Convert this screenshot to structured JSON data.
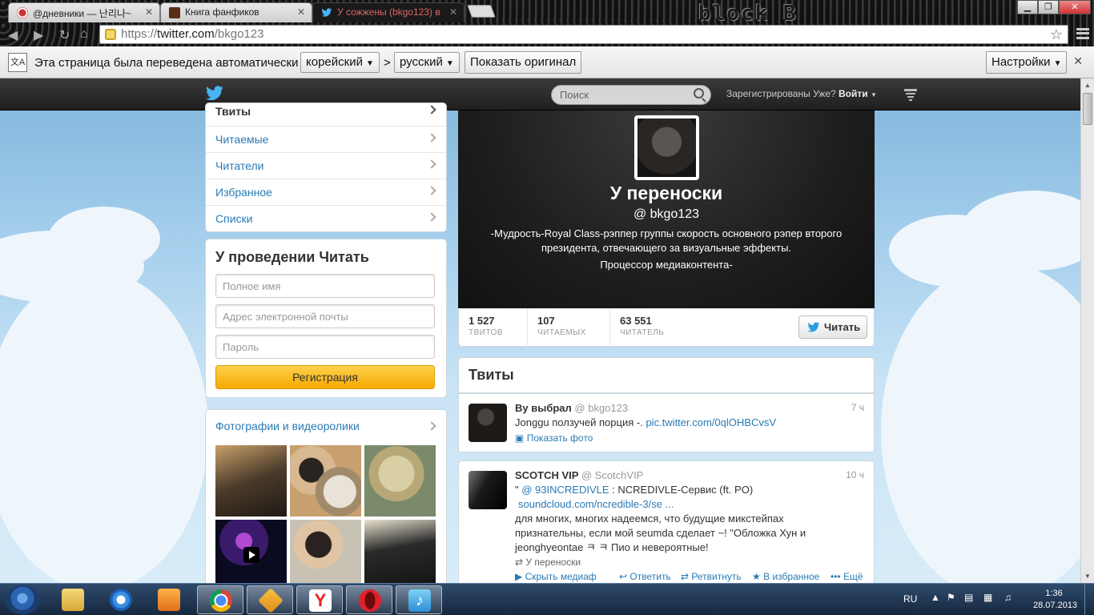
{
  "browser": {
    "tabs": [
      {
        "title": "@дневники — 난리나~",
        "active": false
      },
      {
        "title": "Книга фанфиков",
        "active": false
      },
      {
        "title": "У сожжены (bkgo123) в",
        "active": true
      }
    ],
    "brand_logo": "block B",
    "url_scheme": "https://",
    "url_host": "twitter.com",
    "url_path": "/bkgo123",
    "translate_bar": {
      "message": "Эта страница была переведена автоматически",
      "from_lang": "корейский",
      "separator": ">",
      "to_lang": "русский",
      "show_original": "Показать оригинал",
      "settings": "Настройки"
    }
  },
  "twitter": {
    "search_placeholder": "Поиск",
    "login_question": "Зарегистрированы Уже?",
    "login_label": "Войти",
    "nav": [
      {
        "label": "Твиты"
      },
      {
        "label": "Читаемые"
      },
      {
        "label": "Читатели"
      },
      {
        "label": "Избранное"
      },
      {
        "label": "Списки"
      }
    ],
    "signup": {
      "title": "У проведении Читать",
      "name_placeholder": "Полное имя",
      "email_placeholder": "Адрес электронной почты",
      "password_placeholder": "Пароль",
      "button": "Регистрация"
    },
    "media_title": "Фотографии и видеоролики",
    "profile": {
      "name": "У переноски",
      "handle": "@ bkgo123",
      "bio": "-Мудрость-Royal Class-рэппер группы скорость основного рэпер второго президента, отвечающего за визуальные эффекты.",
      "bio2": "Процессор медиаконтента-"
    },
    "stats": [
      {
        "value": "1 527",
        "label": "ТВИТОВ"
      },
      {
        "value": "107",
        "label": "ЧИТАЕМЫХ"
      },
      {
        "value": "63 551",
        "label": "ЧИТАТЕЛЬ"
      }
    ],
    "follow_button": "Читать",
    "tweets_header": "Твиты",
    "tweets": [
      {
        "name": "Ву выбрал",
        "handle": "@ bkgo123",
        "time": "7 ч",
        "text": "Jonggu ползучей порция -.",
        "link": "pic.twitter.com/0qlOHBCvsV",
        "show_photo": "Показать фото"
      },
      {
        "name": "SCOTCH VIP",
        "handle": "@ ScotchVIP",
        "time": "10 ч",
        "quote_open": "\"",
        "mention": "@ 93INCREDIVLE",
        "line1_rest": ": NCREDIVLE-Сервис (ft. PO)",
        "link": "soundcloud.com/ncredible-3/se ...",
        "body": "для многих, многих надеемся, что будущие микстейпах признательны, если мой seumda сделает ~! \"Обложка Хун и jeonghyeontae ㅋ ㅋ Пио и невероятные!",
        "retweeted_by": "У переноски",
        "actions": {
          "hide_media": "Скрыть медиаф",
          "reply": "Ответить",
          "retweet": "Ретвитнуть",
          "favorite": "В избранное",
          "more": "Ещё"
        }
      }
    ]
  },
  "taskbar": {
    "language": "RU",
    "time": "1:36",
    "date": "28.07.2013"
  },
  "colors": {
    "twitter_blue": "#2a7bb5",
    "signup_yellow": "#f5a800",
    "sky": "#a9d1ee"
  }
}
